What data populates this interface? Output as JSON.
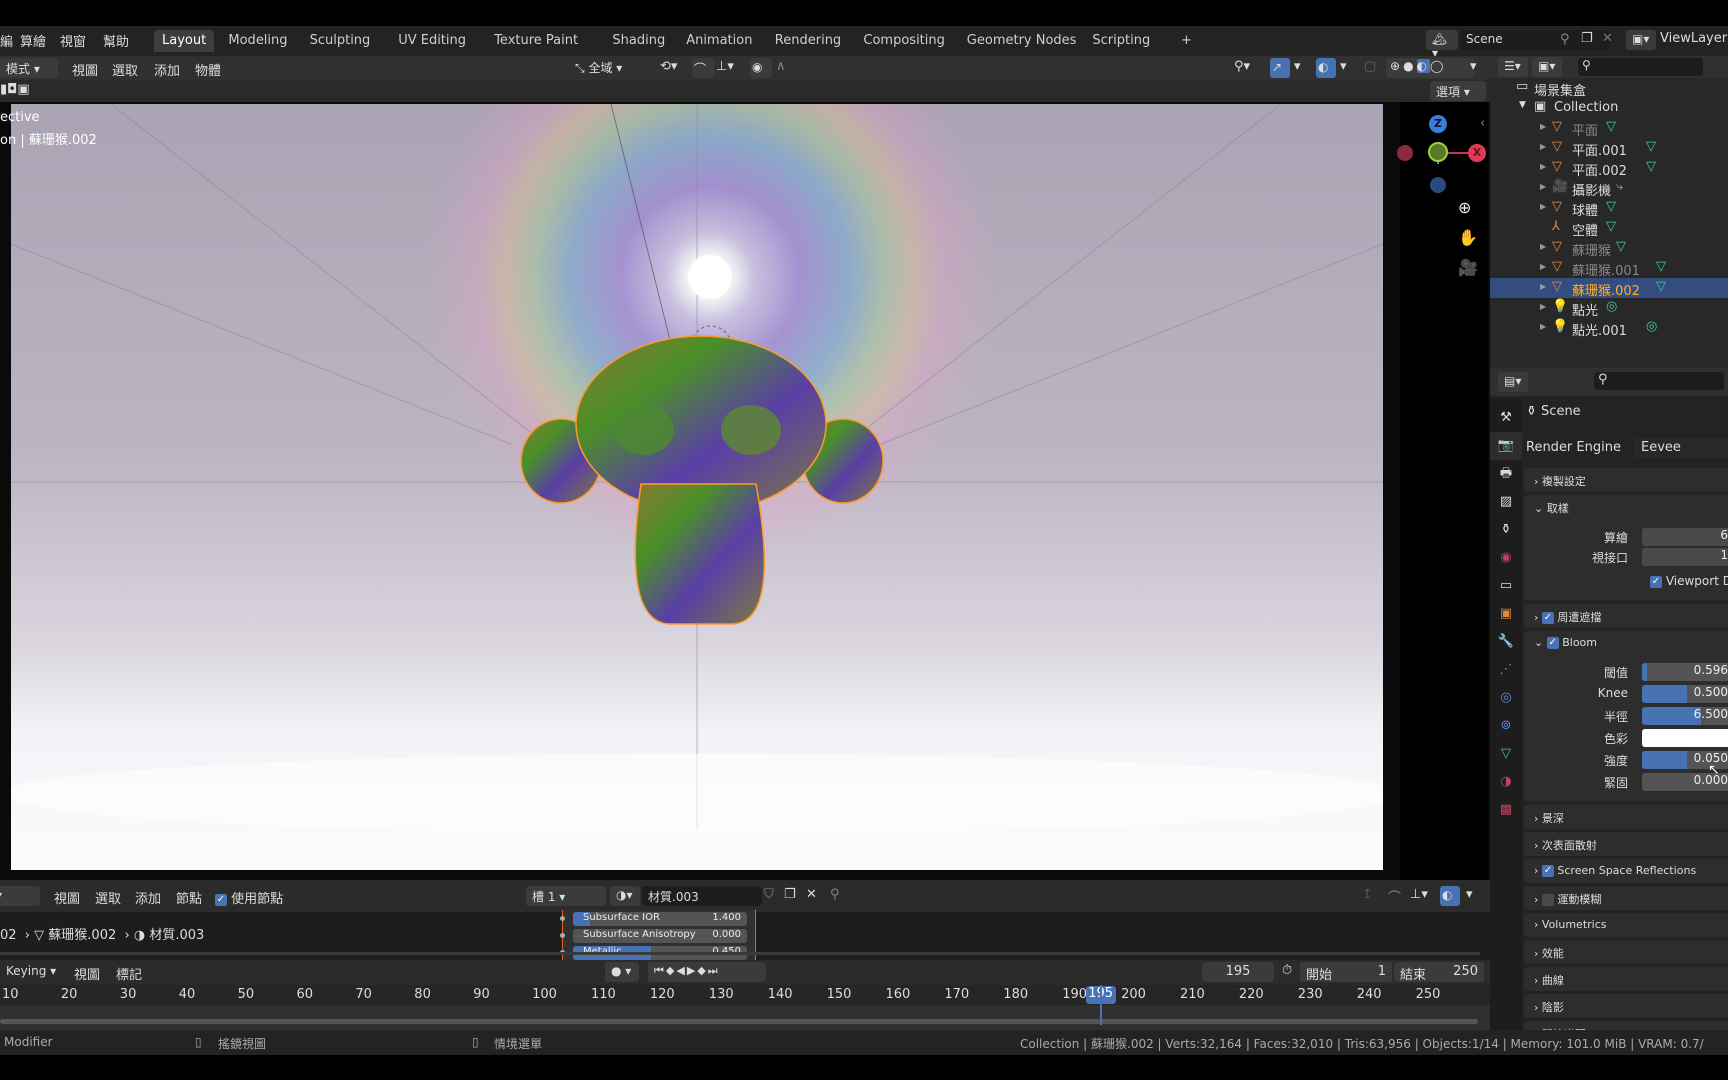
{
  "menu": {
    "items": [
      "編",
      "算繪",
      "視窗",
      "幫助"
    ]
  },
  "workspaces": [
    "Layout",
    "Modeling",
    "Sculpting",
    "UV Editing",
    "Texture Paint",
    "Shading",
    "Animation",
    "Rendering",
    "Compositing",
    "Geometry Nodes",
    "Scripting",
    "+"
  ],
  "active_workspace": "Layout",
  "scene": {
    "name": "Scene",
    "view_layer": "ViewLayer"
  },
  "viewport": {
    "mode": "模式",
    "menus": [
      "視圖",
      "選取",
      "添加",
      "物體"
    ],
    "orientation": "全域",
    "options_label": "選項",
    "overlay_text_1": "ective",
    "overlay_text_2": "on | 蘇珊猴.002",
    "gizmo": {
      "z": "Z",
      "x": "X"
    }
  },
  "outliner": {
    "root": "場景集盒",
    "collection": "Collection",
    "items": [
      {
        "name": "平面",
        "type": "mesh",
        "dim": true
      },
      {
        "name": "平面.001",
        "type": "mesh"
      },
      {
        "name": "平面.002",
        "type": "mesh"
      },
      {
        "name": "攝影機",
        "type": "camera"
      },
      {
        "name": "球體",
        "type": "mesh"
      },
      {
        "name": "空體",
        "type": "empty"
      },
      {
        "name": "蘇珊猴",
        "type": "mesh",
        "dim": true
      },
      {
        "name": "蘇珊猴.001",
        "type": "mesh",
        "dim": true
      },
      {
        "name": "蘇珊猴.002",
        "type": "mesh",
        "selected": true
      },
      {
        "name": "點光",
        "type": "light"
      },
      {
        "name": "點光.001",
        "type": "light"
      }
    ]
  },
  "properties": {
    "context": "Scene",
    "render_engine_label": "Render Engine",
    "render_engine": "Eevee",
    "panels": {
      "copy": "複製設定",
      "sampling": "取樣",
      "render_label": "算繪",
      "render_value": "6",
      "viewport_label": "視接口",
      "viewport_value": "1",
      "viewport_denoise": "Viewport D",
      "ao": "周遭遮擋",
      "bloom": "Bloom",
      "dof": "景深",
      "sss": "次表面散射",
      "ssr": "Screen Space Reflections",
      "motion_blur": "運動模糊",
      "volumetrics": "Volumetrics",
      "performance": "效能",
      "curves": "曲線",
      "shadows": "陰影",
      "indirect": "間接光照"
    },
    "bloom": [
      {
        "label": "閾值",
        "value": "0.596",
        "fraction": 0.06
      },
      {
        "label": "Knee",
        "value": "0.500",
        "fraction": 0.5
      },
      {
        "label": "半徑",
        "value": "6.500",
        "fraction": 0.65
      },
      {
        "label": "色彩",
        "value": "",
        "color": "#ffffff"
      },
      {
        "label": "強度",
        "value": "0.050",
        "fraction": 0.5
      },
      {
        "label": "緊固",
        "value": "0.000",
        "fraction": 0
      }
    ]
  },
  "node_editor": {
    "menus": [
      "視圖",
      "選取",
      "添加",
      "節點"
    ],
    "use_nodes": "使用節點",
    "slot": "槽 1",
    "material": "材質.003",
    "breadcrumb": [
      "02",
      "蘇珊猴.002",
      "材質.003"
    ],
    "sockets": [
      {
        "label": "Subsurface IOR",
        "value": "1.400",
        "fraction": 0.1
      },
      {
        "label": "Subsurface Anisotropy",
        "value": "0.000",
        "fraction": 0
      },
      {
        "label": "Metallic",
        "value": "0.450",
        "fraction": 0.45
      }
    ]
  },
  "timeline": {
    "keying": "Keying",
    "menus": [
      "視圖",
      "標記"
    ],
    "current_frame": "195",
    "start_label": "開始",
    "start": "1",
    "end_label": "結束",
    "end": "250",
    "ticks": [
      "10",
      "20",
      "30",
      "40",
      "50",
      "60",
      "70",
      "80",
      "90",
      "100",
      "110",
      "120",
      "130",
      "140",
      "150",
      "160",
      "170",
      "180",
      "190",
      "200",
      "210",
      "220",
      "230",
      "240",
      "250"
    ]
  },
  "status": {
    "left": "Modifier",
    "middle": "搖鏡視圖",
    "right": "情境選單",
    "stats": "Collection | 蘇珊猴.002 | Verts:32,164 | Faces:32,010 | Tris:63,956 | Objects:1/14 | Memory: 101.0 MiB | VRAM: 0.7/"
  },
  "colors": {
    "accent": "#4772b3",
    "selected_row": "#334d80",
    "selected_text": "#ffaf29",
    "mesh_icon": "#e08a3c",
    "data_icon": "#3ecf8e"
  }
}
